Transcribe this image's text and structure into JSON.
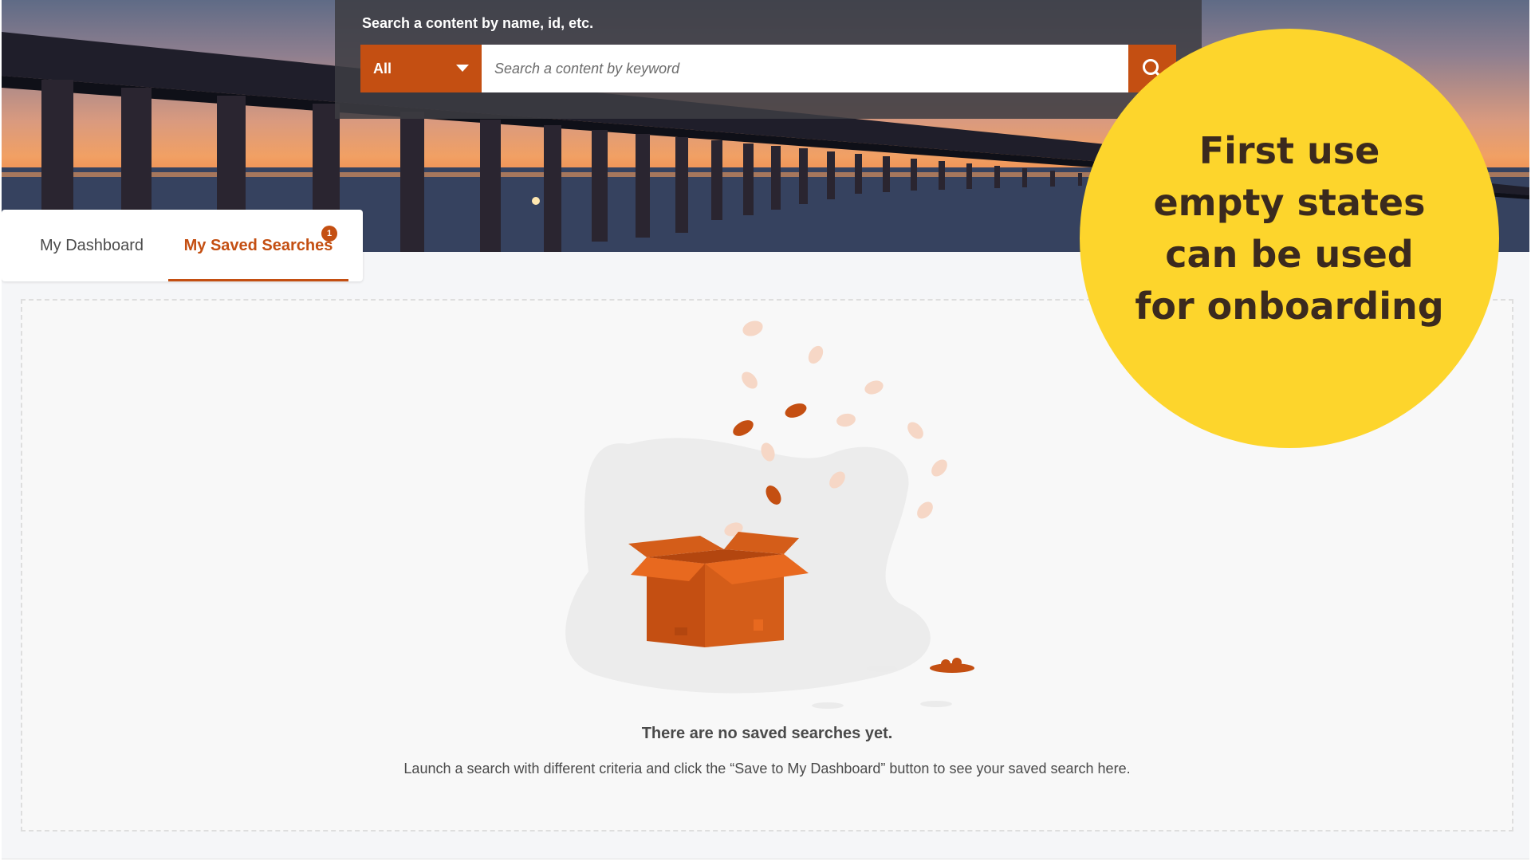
{
  "search": {
    "caption": "Search a content by name, id, etc.",
    "scope_value": "All",
    "placeholder": "Search a content by keyword",
    "search_icon": "search-icon"
  },
  "tabs": [
    {
      "label": "My Dashboard",
      "active": false
    },
    {
      "label": "My Saved Searches",
      "active": true,
      "badge": "1"
    }
  ],
  "empty_state": {
    "title": "There are no saved searches yet.",
    "description": "Launch a search with different criteria and click the “Save to My Dashboard” button to see your saved search here.",
    "illustration": "open-box-illustration"
  },
  "callout": {
    "text": "First use empty states can be used for onboarding"
  },
  "colors": {
    "accent": "#c44f12",
    "callout": "#fdd52c",
    "callout_text": "#3b2a1e"
  }
}
